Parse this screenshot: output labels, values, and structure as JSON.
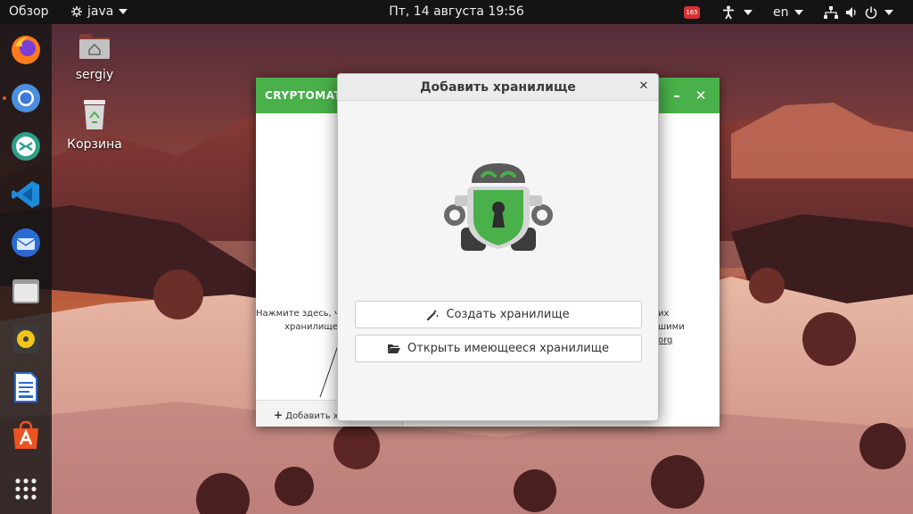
{
  "topbar": {
    "activities": "Обзор",
    "app_name": "java",
    "clock": "Пт, 14 августа  19:56",
    "tray_badge": "165",
    "language": "en"
  },
  "dock": {
    "items": [
      {
        "name": "firefox-icon",
        "running": false
      },
      {
        "name": "chromium-icon",
        "running": true
      },
      {
        "name": "remote-desktop-icon",
        "running": false
      },
      {
        "name": "vscode-icon",
        "running": false
      },
      {
        "name": "thunderbird-icon",
        "running": false
      },
      {
        "name": "files-icon",
        "running": false
      },
      {
        "name": "rhythmbox-icon",
        "running": false
      },
      {
        "name": "libreoffice-writer-icon",
        "running": false
      },
      {
        "name": "software-center-icon",
        "running": false
      },
      {
        "name": "show-applications-icon",
        "running": false
      }
    ]
  },
  "desktop": {
    "home_label": "sergiy",
    "trash_label": "Корзина"
  },
  "main_window": {
    "title": "CRYPTOMATOR",
    "add_vault_label": "Добавить хранилище",
    "hint_left_line1": "Нажмите здесь, чтобы добавить",
    "hint_left_line2": "хранилище",
    "hint_right_line1": "их",
    "hint_right_line2": "шими",
    "hint_right_link": "org",
    "accent_color": "#49b04a"
  },
  "dialog": {
    "title": "Добавить хранилище",
    "create_label": "Создать хранилище",
    "open_label": "Открыть имеющееся хранилище"
  }
}
